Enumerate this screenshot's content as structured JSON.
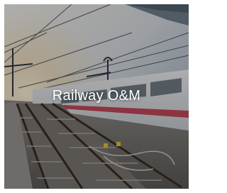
{
  "card": {
    "caption": "Railway O&M"
  },
  "colors": {
    "overlay": "#000000",
    "caption_text": "#ffffff",
    "train_stripe": "#c0394b"
  },
  "image": {
    "subject": "photo"
  }
}
